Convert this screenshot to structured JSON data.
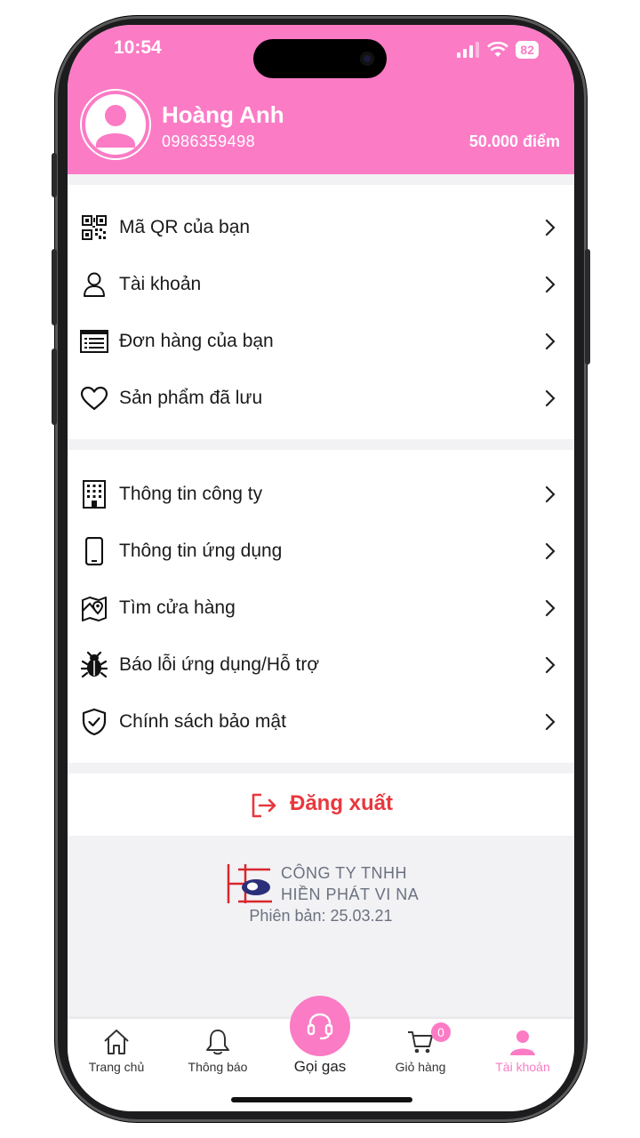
{
  "status": {
    "time": "10:54",
    "battery": "82"
  },
  "profile": {
    "name": "Hoàng Anh",
    "phone": "0986359498",
    "points": "50.000 điểm"
  },
  "menu_group_1": [
    {
      "label": "Mã QR của bạn",
      "icon": "qr-code-icon"
    },
    {
      "label": "Tài khoản",
      "icon": "user-icon"
    },
    {
      "label": "Đơn hàng của bạn",
      "icon": "order-list-icon"
    },
    {
      "label": "Sản phẩm đã lưu",
      "icon": "heart-icon"
    }
  ],
  "menu_group_2": [
    {
      "label": "Thông tin công ty",
      "icon": "building-icon"
    },
    {
      "label": "Thông tin ứng dụng",
      "icon": "phone-icon"
    },
    {
      "label": "Tìm cửa hàng",
      "icon": "map-icon"
    },
    {
      "label": "Báo lỗi ứng dụng/Hỗ trợ",
      "icon": "bug-icon"
    },
    {
      "label": "Chính sách bảo mật",
      "icon": "shield-icon"
    }
  ],
  "logout": {
    "label": "Đăng xuất"
  },
  "company": {
    "line1": "CÔNG TY TNHH",
    "line2": "HIỀN PHÁT VI NA",
    "version": "Phiên bản: 25.03.21"
  },
  "tabbar": {
    "home": "Trang chủ",
    "notifications": "Thông báo",
    "call": "Gọi gas",
    "cart": "Giỏ hàng",
    "cart_count": "0",
    "account": "Tài khoản"
  },
  "colors": {
    "brand": "#fb7bc5",
    "logout": "#e8383d",
    "text": "#1a1a1a"
  }
}
